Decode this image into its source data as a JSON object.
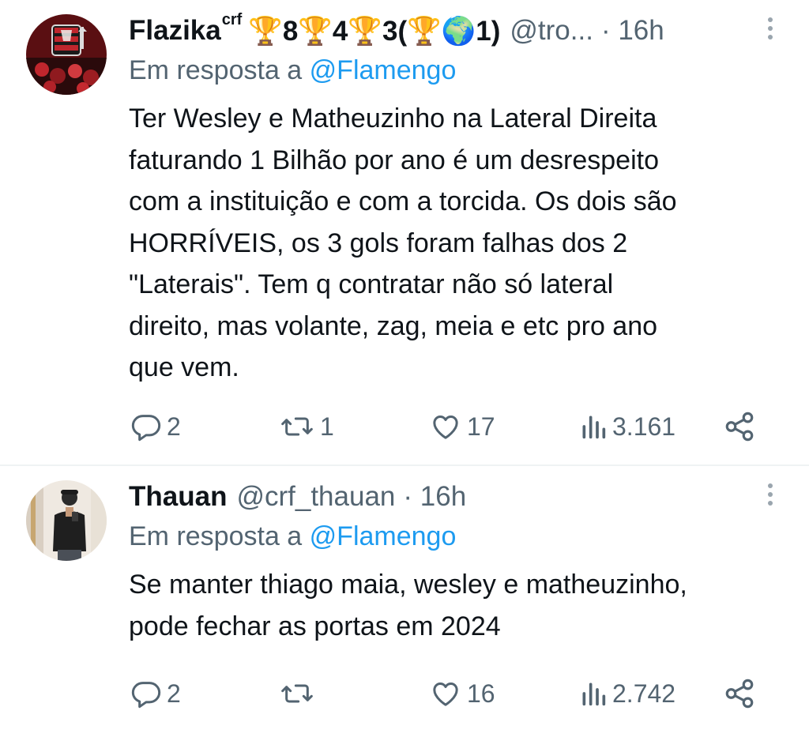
{
  "tweets": [
    {
      "name": "Flazika",
      "name_sup": "crf",
      "badges": "🏆8🏆4🏆3(🏆🌍1)",
      "handle": "@tro...",
      "time": "· 16h",
      "reply_prefix": "Em resposta a",
      "reply_mention": "@Flamengo",
      "text_lines": [
        "Ter Wesley e Matheuzinho na Lateral Direita",
        "faturando 1 Bilhão por ano é um desrespeito",
        "com a instituição e com a torcida. Os dois são",
        "HORRÍVEIS, os 3 gols foram falhas dos 2",
        "\"Laterais\". Tem q contratar não só lateral",
        "direito, mas volante, zag, meia e etc pro ano",
        "que vem."
      ],
      "replies": "2",
      "retweets": "1",
      "likes": "17",
      "views": "3.161"
    },
    {
      "name": "Thauan",
      "handle": "@crf_thauan",
      "time": "· 16h",
      "reply_prefix": "Em resposta a",
      "reply_mention": "@Flamengo",
      "text_lines": [
        "Se manter thiago maia, wesley e matheuzinho,",
        "pode fechar as portas em 2024"
      ],
      "replies": "2",
      "retweets": "",
      "likes": "16",
      "views": "2.742"
    }
  ],
  "icons": {
    "reply": "reply-icon",
    "retweet": "retweet-icon",
    "like": "heart-icon",
    "views": "views-icon",
    "share": "share-icon",
    "more": "more-icon"
  },
  "colors": {
    "text": "#0f1419",
    "secondary": "#536471",
    "mention": "#1d9bf0",
    "divider": "#eff3f4"
  }
}
